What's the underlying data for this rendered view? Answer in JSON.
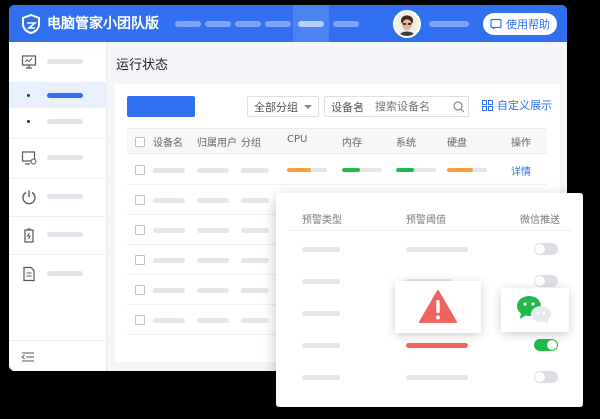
{
  "header": {
    "app_title": "电脑管家小团队版",
    "help_label": "使用帮助",
    "accent_color": "#2f6ff0"
  },
  "main": {
    "page_title": "运行状态",
    "filter_group": "全部分组",
    "filter_device": "设备名",
    "search_placeholder": "搜索设备名",
    "custom_display": "自定义展示"
  },
  "table": {
    "headers": [
      "设备名",
      "归属用户",
      "分组",
      "CPU",
      "内存",
      "系统",
      "硬盘",
      "操作"
    ],
    "detail_label": "详情",
    "first_row_usage": {
      "cpu": 0.6,
      "memory": 0.45,
      "system": 0.45,
      "disk": 0.65
    }
  },
  "popup": {
    "headers": [
      "预警类型",
      "预警阈值",
      "微信推送"
    ],
    "toggles": [
      false,
      false,
      false,
      true,
      false
    ],
    "status_colors": {
      "alert": "#f0645f",
      "on": "#22b94b"
    }
  },
  "icons": [
    "shield-logo-icon",
    "monitor-icon",
    "display-settings-icon",
    "power-icon",
    "battery-icon",
    "document-icon",
    "collapse-icon",
    "search-icon",
    "grid-icon",
    "warning-icon",
    "wechat-icon"
  ]
}
